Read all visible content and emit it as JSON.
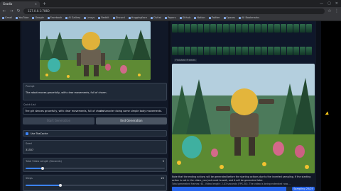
{
  "browser": {
    "tab_title": "Gradio",
    "tab_close": "×",
    "new_tab": "+",
    "controls": [
      "—",
      "▢",
      "✕"
    ],
    "url": "127.0.0.1:7860",
    "bookmarks": [
      "Gmail",
      "YouTube",
      "Google",
      "Facebook",
      "AI Gallery",
      "Lmsys",
      "Reddit",
      "Discord",
      "Huggingface",
      "Civitai",
      "Papers",
      "Github",
      "Notion",
      "Twitter",
      "Spaces",
      "All Bookmarks"
    ]
  },
  "left_panel": {
    "prompt_label": "Prompt",
    "prompt_text": "The robot moves gracefully, with clear movements, full of charm.",
    "quick_list_label": "Quick List",
    "quick_items": [
      "The girl dances gracefully, with clear movements, full of charm.",
      "A character doing some simple body movements."
    ],
    "start_button": "Start Generation",
    "end_button": "End Generation",
    "teacache_label": "Use TeaCache",
    "seed_label": "Seed",
    "seed_value": "31337",
    "video_length_label": "Total Video Length (Seconds)",
    "video_length_value": "5",
    "video_length_fraction": 0.12,
    "steps_label": "Steps",
    "steps_value": "25",
    "steps_fraction": 0.25
  },
  "right_panel": {
    "finished_label": "Finished Frames",
    "note_text": "Note that the ending actions will be generated before the starting actions due to the inverted sampling. If the starting action is not in the video, you just need to wait, and it will be generated later.",
    "status_text": "Total generated frames: 61, Video length: 2.03 seconds (FPS-30). The video is being extended now ...",
    "sampling_label": "Sampling 25/25",
    "progress_fraction": 0.8
  },
  "colors": {
    "accent": "#3b82f6",
    "primary_button": "#374151",
    "panel": "#1f2937",
    "background": "#0b0f19"
  }
}
